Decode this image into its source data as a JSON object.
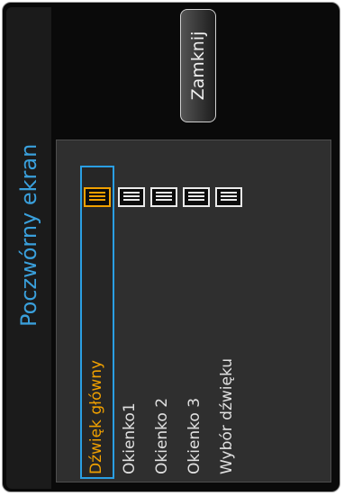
{
  "title": "Poczwórny ekran",
  "close_label": "Zamknij",
  "items": [
    {
      "label": "Dźwięk główny",
      "selected": true
    },
    {
      "label": "Okienko1",
      "selected": false
    },
    {
      "label": "Okienko 2",
      "selected": false
    },
    {
      "label": "Okienko 3",
      "selected": false
    },
    {
      "label": "Wybór dźwięku",
      "selected": false
    }
  ],
  "sound_icons": [
    {
      "name": "sound-level-icon",
      "active": true
    },
    {
      "name": "sound-level-icon",
      "active": false
    },
    {
      "name": "sound-level-icon",
      "active": false
    },
    {
      "name": "sound-level-icon",
      "active": false
    },
    {
      "name": "sound-level-icon",
      "active": false
    }
  ],
  "colors": {
    "accent": "#2a9fe3",
    "selected_text": "#f0a000",
    "title": "#3aa0dc"
  }
}
